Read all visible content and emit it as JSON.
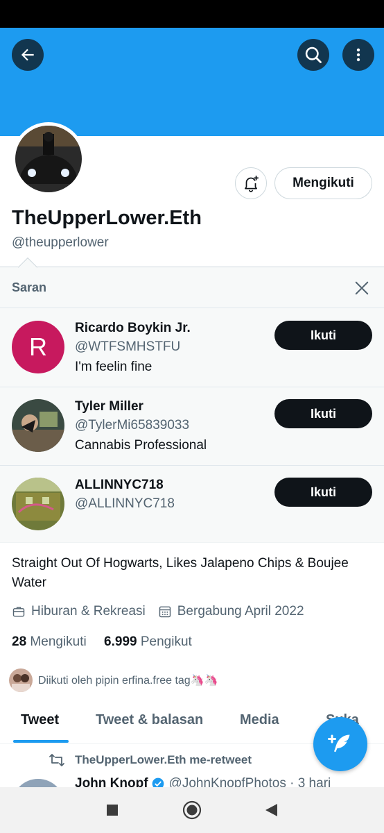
{
  "header": {
    "back_icon": "back-arrow-icon",
    "search_icon": "search-icon",
    "more_icon": "more-vertical-icon",
    "banner_color": "#1d9bf0"
  },
  "profile": {
    "display_name": "TheUpperLower.Eth",
    "handle": "@theupperlower",
    "notify_icon": "bell-plus-icon",
    "following_label": "Mengikuti",
    "bio": "Straight Out Of Hogwarts, Likes Jalapeno Chips & Boujee Water",
    "category": "Hiburan & Rekreasi",
    "joined": "Bergabung April 2022",
    "following_count": "28",
    "following_label_text": "Mengikuti",
    "followers_count": "6.999",
    "followers_label_text": "Pengikut",
    "followed_by": "Diikuti oleh pipin erfina.free tag🦄🦄"
  },
  "suggestions": {
    "title": "Saran",
    "close_icon": "close-icon",
    "items": [
      {
        "name": "Ricardo Boykin Jr.",
        "handle": "@WTFSMHSTFU",
        "bio": "I'm feelin fine",
        "avatar_letter": "R",
        "avatar_color": "#c7195e",
        "follow_label": "Ikuti"
      },
      {
        "name": "Tyler Miller",
        "handle": "@TylerMi65839033",
        "bio": "Cannabis Professional",
        "follow_label": "Ikuti"
      },
      {
        "name": "ALLINNYC718",
        "handle": "@ALLINNYC718",
        "bio": "",
        "follow_label": "Ikuti"
      }
    ]
  },
  "tabs": [
    {
      "label": "Tweet",
      "active": true
    },
    {
      "label": "Tweet & balasan",
      "active": false
    },
    {
      "label": "Media",
      "active": false
    },
    {
      "label": "Suka",
      "active": false
    }
  ],
  "timeline": {
    "retweet_label": "TheUpperLower.Eth me-retweet",
    "tweet_author": "John Knopf",
    "tweet_handle": "@JohnKnopfPhotos · 3 hari"
  },
  "fab": {
    "icon": "compose-feather-icon"
  },
  "nav": {
    "icons": [
      "recent-apps-icon",
      "home-icon",
      "back-triangle-icon"
    ]
  },
  "colors": {
    "accent": "#1d9bf0",
    "text": "#0f1419",
    "muted": "#536471"
  }
}
